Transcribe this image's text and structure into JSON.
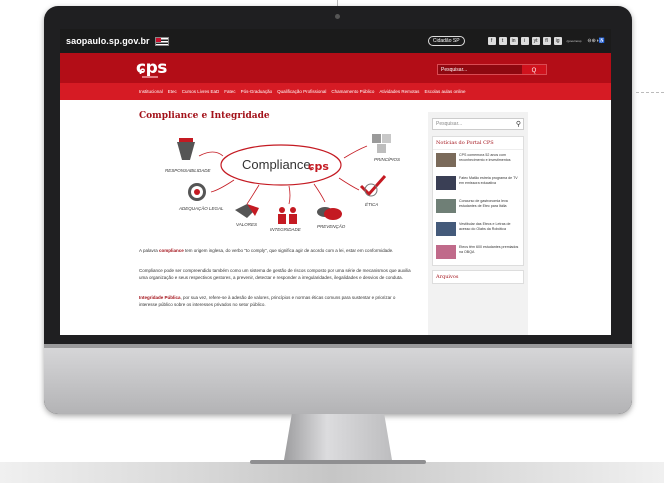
{
  "site": {
    "gov_label": "saopaulo.sp.gov.br",
    "cidadao_label": "Cidadão SP",
    "social_icons": [
      "f",
      "t",
      "in",
      "i",
      "yt",
      "fl",
      "ig"
    ],
    "social_caption": "/governosp",
    "accessibility_label": "⊖⊕◑♿",
    "logo_text": "ɕps",
    "search_placeholder": "Pesquisar...",
    "search_button": "Q"
  },
  "nav": {
    "items": [
      "Institucional",
      "Etec",
      "Cursos Livres EaD",
      "Fatec",
      "Pós-Graduação",
      "Qualificação Profissional",
      "Chamamento Público",
      "Atividades Remotas",
      "Escolas aulas online"
    ]
  },
  "main": {
    "title": "Compliance e Integridade",
    "diagram": {
      "center_label": "Compliance",
      "center_brand": "ɕps",
      "labels": {
        "responsabilidade": "RESPONSABILIDADE",
        "principios": "PRINCÍPIOS",
        "adequacao": "ADEQUAÇÃO LEGAL",
        "valores": "VALORES",
        "integridade": "INTEGRIDADE",
        "prevencao": "PREVENÇÃO",
        "etica": "ÉTICA"
      }
    },
    "paragraphs": {
      "p1_pre": "A palavra ",
      "p1_bold": "compliance",
      "p1_post": " tem origem inglesa, do verbo \"to comply\", que significa agir de acordo com a lei, estar em conformidade.",
      "p2": "Compliance pode ser compreendido também como um sistema de gestão de riscos composto por uma série de mecanismos que auxilia uma organização e seus respectivos gestores, a prevenir, detectar e responder a irregularidades, ilegalidades e desvios de conduta.",
      "p3_bold": "Integridade Pública",
      "p3_post": ", por sua vez, refere-se à adesão de valores, princípios e normas éticas comuns para sustentar e priorizar o interesse público sobre os interesses privados no setor público."
    }
  },
  "sidebar": {
    "search_placeholder": "Pesquisar...",
    "news_title": "Notícias do Portal CPS",
    "news": [
      {
        "text": "CPS comemora 52 anos com reconhecimento e investimentos",
        "color": "#7a6a5a"
      },
      {
        "text": "Fatec Matão estreia programa de TV em emissora educativa",
        "color": "#3a3f55"
      },
      {
        "text": "Concurso de gastronomia leva estudantes de Etec para Itália",
        "color": "#6f7f76"
      },
      {
        "text": "Vestibular das Etecs e Letras de acesso do Olabs da Robótica",
        "color": "#445a7a"
      },
      {
        "text": "Etecs têm 600 estudantes premiados na OBQA",
        "color": "#c06a8a"
      }
    ],
    "arquivos_title": "Arquivos"
  },
  "colors": {
    "brand_red": "#b30d17",
    "nav_red": "#d61b24",
    "title_red": "#a3121a",
    "topbar": "#1b1b1b"
  }
}
